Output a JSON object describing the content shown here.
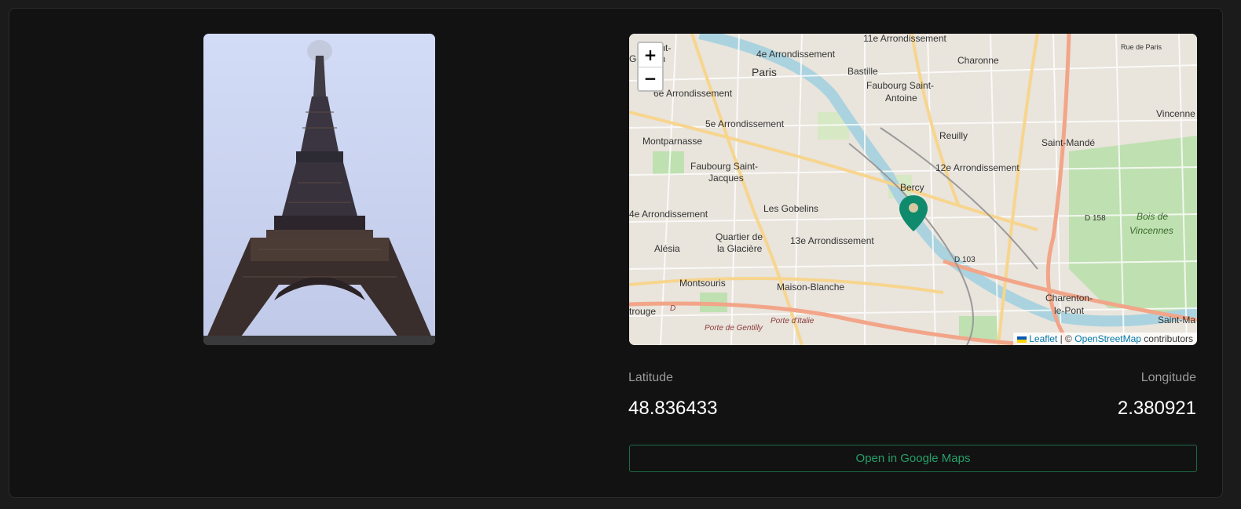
{
  "photo": {
    "alt": "Eiffel Tower"
  },
  "map": {
    "zoom_in": "+",
    "zoom_out": "−",
    "labels": [
      "11e Arrondissement",
      "Saint-",
      "Germain",
      "4e Arrondissement",
      "Paris",
      "Bastille",
      "Charonne",
      "Faubourg Saint-",
      "Antoine",
      "6e Arrondissement",
      "5e Arrondissement",
      "Vincenne",
      "Reuilly",
      "Montparnasse",
      "Saint-Mandé",
      "Faubourg Saint-",
      "Jacques",
      "12e Arrondissement",
      "Bercy",
      "4e Arrondissement",
      "Les Gobelins",
      "D 158",
      "Bois de",
      "Vincennes",
      "Quartier de",
      "la Glacière",
      "13e Arrondissement",
      "Alésia",
      "D 103",
      "Montsouris",
      "Maison-Blanche",
      "Charenton-",
      "le-Pont",
      "Saint-Ma",
      "Rue de Paris",
      "trouge",
      "Porte de Gentilly",
      "Porte d'Italie",
      "D"
    ],
    "attribution": {
      "leaflet": "Leaflet",
      "separator": "| ©",
      "osm": "OpenStreetMap",
      "suffix": "contributors"
    },
    "marker_color": "#0f8a6c"
  },
  "coords": {
    "latitude_label": "Latitude",
    "latitude": "48.836433",
    "longitude_label": "Longitude",
    "longitude": "2.380921"
  },
  "actions": {
    "open_google_maps": "Open in Google Maps"
  },
  "colors": {
    "accent": "#26a06a",
    "background": "#121212"
  }
}
